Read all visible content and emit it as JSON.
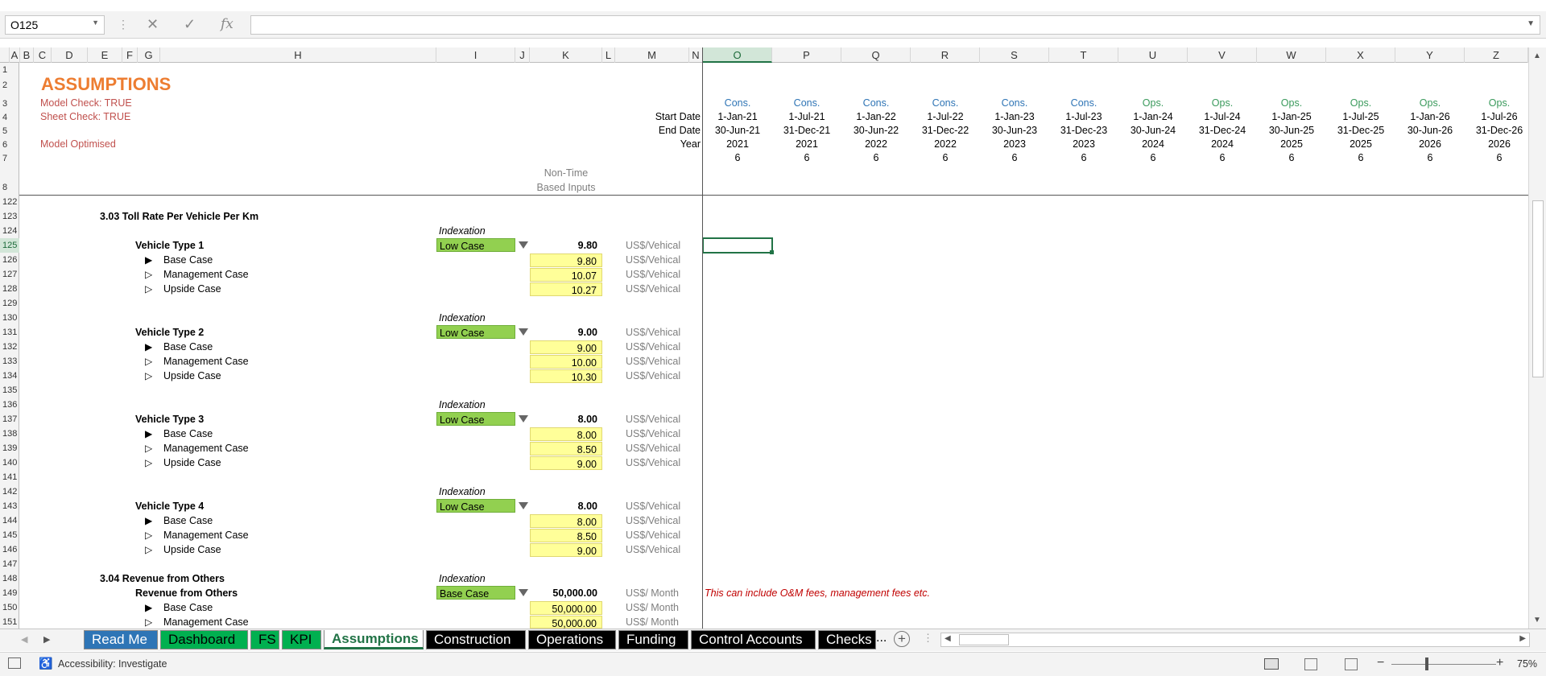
{
  "formula_bar": {
    "name_box": "O125",
    "fx_label": "fx",
    "cancel": "✕",
    "enter": "✓",
    "formula": ""
  },
  "columns": [
    "A",
    "B",
    "C",
    "D",
    "E",
    "F",
    "G",
    "H",
    "I",
    "J",
    "K",
    "L",
    "M",
    "N",
    "O",
    "P",
    "Q",
    "R",
    "S",
    "T",
    "U",
    "V",
    "W",
    "X",
    "Y",
    "Z"
  ],
  "rows_top": [
    "1",
    "2",
    "3",
    "4",
    "5",
    "6",
    "7",
    "8"
  ],
  "rows_main": [
    "122",
    "123",
    "124",
    "125",
    "126",
    "127",
    "128",
    "129",
    "130",
    "131",
    "132",
    "133",
    "134",
    "135",
    "136",
    "137",
    "138",
    "139",
    "140",
    "141",
    "142",
    "143",
    "144",
    "145",
    "146",
    "147",
    "148",
    "149",
    "150",
    "151"
  ],
  "header": {
    "title": "ASSUMPTIONS",
    "model_check": "Model Check: TRUE",
    "sheet_check": "Sheet Check: TRUE",
    "model_optimised": "Model Optimised",
    "start_date_label": "Start Date",
    "end_date_label": "End Date",
    "year_label": "Year",
    "non_time_1": "Non-Time",
    "non_time_2": "Based Inputs"
  },
  "timeline": [
    {
      "phase": "Cons.",
      "start": "1-Jan-21",
      "end": "30-Jun-21",
      "year": "2021",
      "months": "6"
    },
    {
      "phase": "Cons.",
      "start": "1-Jul-21",
      "end": "31-Dec-21",
      "year": "2021",
      "months": "6"
    },
    {
      "phase": "Cons.",
      "start": "1-Jan-22",
      "end": "30-Jun-22",
      "year": "2022",
      "months": "6"
    },
    {
      "phase": "Cons.",
      "start": "1-Jul-22",
      "end": "31-Dec-22",
      "year": "2022",
      "months": "6"
    },
    {
      "phase": "Cons.",
      "start": "1-Jan-23",
      "end": "30-Jun-23",
      "year": "2023",
      "months": "6"
    },
    {
      "phase": "Cons.",
      "start": "1-Jul-23",
      "end": "31-Dec-23",
      "year": "2023",
      "months": "6"
    },
    {
      "phase": "Ops.",
      "start": "1-Jan-24",
      "end": "30-Jun-24",
      "year": "2024",
      "months": "6"
    },
    {
      "phase": "Ops.",
      "start": "1-Jul-24",
      "end": "31-Dec-24",
      "year": "2024",
      "months": "6"
    },
    {
      "phase": "Ops.",
      "start": "1-Jan-25",
      "end": "30-Jun-25",
      "year": "2025",
      "months": "6"
    },
    {
      "phase": "Ops.",
      "start": "1-Jul-25",
      "end": "31-Dec-25",
      "year": "2025",
      "months": "6"
    },
    {
      "phase": "Ops.",
      "start": "1-Jan-26",
      "end": "30-Jun-26",
      "year": "2026",
      "months": "6"
    },
    {
      "phase": "Ops.",
      "start": "1-Jul-26",
      "end": "31-Dec-26",
      "year": "2026",
      "months": "6"
    }
  ],
  "section_303": "3.03  Toll Rate Per Vehicle Per Km",
  "section_304": "3.04  Revenue from Others",
  "indexation_label": "Indexation",
  "vehicles": [
    {
      "name": "Vehicle Type 1",
      "selected": "Low Case",
      "value": "9.80",
      "unit": "US$/Vehical",
      "cases": [
        {
          "name": "Base Case",
          "value": "9.80",
          "unit": "US$/Vehical"
        },
        {
          "name": "Management Case",
          "value": "10.07",
          "unit": "US$/Vehical"
        },
        {
          "name": "Upside Case",
          "value": "10.27",
          "unit": "US$/Vehical"
        }
      ]
    },
    {
      "name": "Vehicle Type 2",
      "selected": "Low Case",
      "value": "9.00",
      "unit": "US$/Vehical",
      "cases": [
        {
          "name": "Base Case",
          "value": "9.00",
          "unit": "US$/Vehical"
        },
        {
          "name": "Management Case",
          "value": "10.00",
          "unit": "US$/Vehical"
        },
        {
          "name": "Upside Case",
          "value": "10.30",
          "unit": "US$/Vehical"
        }
      ]
    },
    {
      "name": "Vehicle Type 3",
      "selected": "Low Case",
      "value": "8.00",
      "unit": "US$/Vehical",
      "cases": [
        {
          "name": "Base Case",
          "value": "8.00",
          "unit": "US$/Vehical"
        },
        {
          "name": "Management Case",
          "value": "8.50",
          "unit": "US$/Vehical"
        },
        {
          "name": "Upside Case",
          "value": "9.00",
          "unit": "US$/Vehical"
        }
      ]
    },
    {
      "name": "Vehicle Type 4",
      "selected": "Low Case",
      "value": "8.00",
      "unit": "US$/Vehical",
      "cases": [
        {
          "name": "Base Case",
          "value": "8.00",
          "unit": "US$/Vehical"
        },
        {
          "name": "Management Case",
          "value": "8.50",
          "unit": "US$/Vehical"
        },
        {
          "name": "Upside Case",
          "value": "9.00",
          "unit": "US$/Vehical"
        }
      ]
    }
  ],
  "revenue_others": {
    "name": "Revenue from Others",
    "selected": "Base Case",
    "value": "50,000.00",
    "unit": "US$/ Month",
    "note": "This can include O&M fees, management fees etc.",
    "cases": [
      {
        "name": "Base Case",
        "value": "50,000.00",
        "unit": "US$/ Month"
      },
      {
        "name": "Management Case",
        "value": "50,000.00",
        "unit": "US$/ Month"
      }
    ]
  },
  "tabs": [
    {
      "label": "Read Me",
      "bg": "#2e75b6",
      "fg": "#ffffff"
    },
    {
      "label": "Dashboard",
      "bg": "#00b050",
      "fg": "#000000"
    },
    {
      "label": "FS",
      "bg": "#00b050",
      "fg": "#000000"
    },
    {
      "label": "KPI",
      "bg": "#00b050",
      "fg": "#000000"
    },
    {
      "label": "Assumptions",
      "bg": "#ffffff",
      "fg": "#217346",
      "active": true
    },
    {
      "label": "Construction",
      "bg": "#000000",
      "fg": "#ffffff"
    },
    {
      "label": "Operations",
      "bg": "#000000",
      "fg": "#ffffff"
    },
    {
      "label": "Funding",
      "bg": "#000000",
      "fg": "#ffffff"
    },
    {
      "label": "Control Accounts",
      "bg": "#000000",
      "fg": "#ffffff"
    },
    {
      "label": "Checks",
      "bg": "#000000",
      "fg": "#ffffff"
    }
  ],
  "tab_overflow": "...",
  "status": {
    "accessibility": "Accessibility: Investigate",
    "zoom": "75%",
    "minus": "−",
    "plus": "+"
  }
}
